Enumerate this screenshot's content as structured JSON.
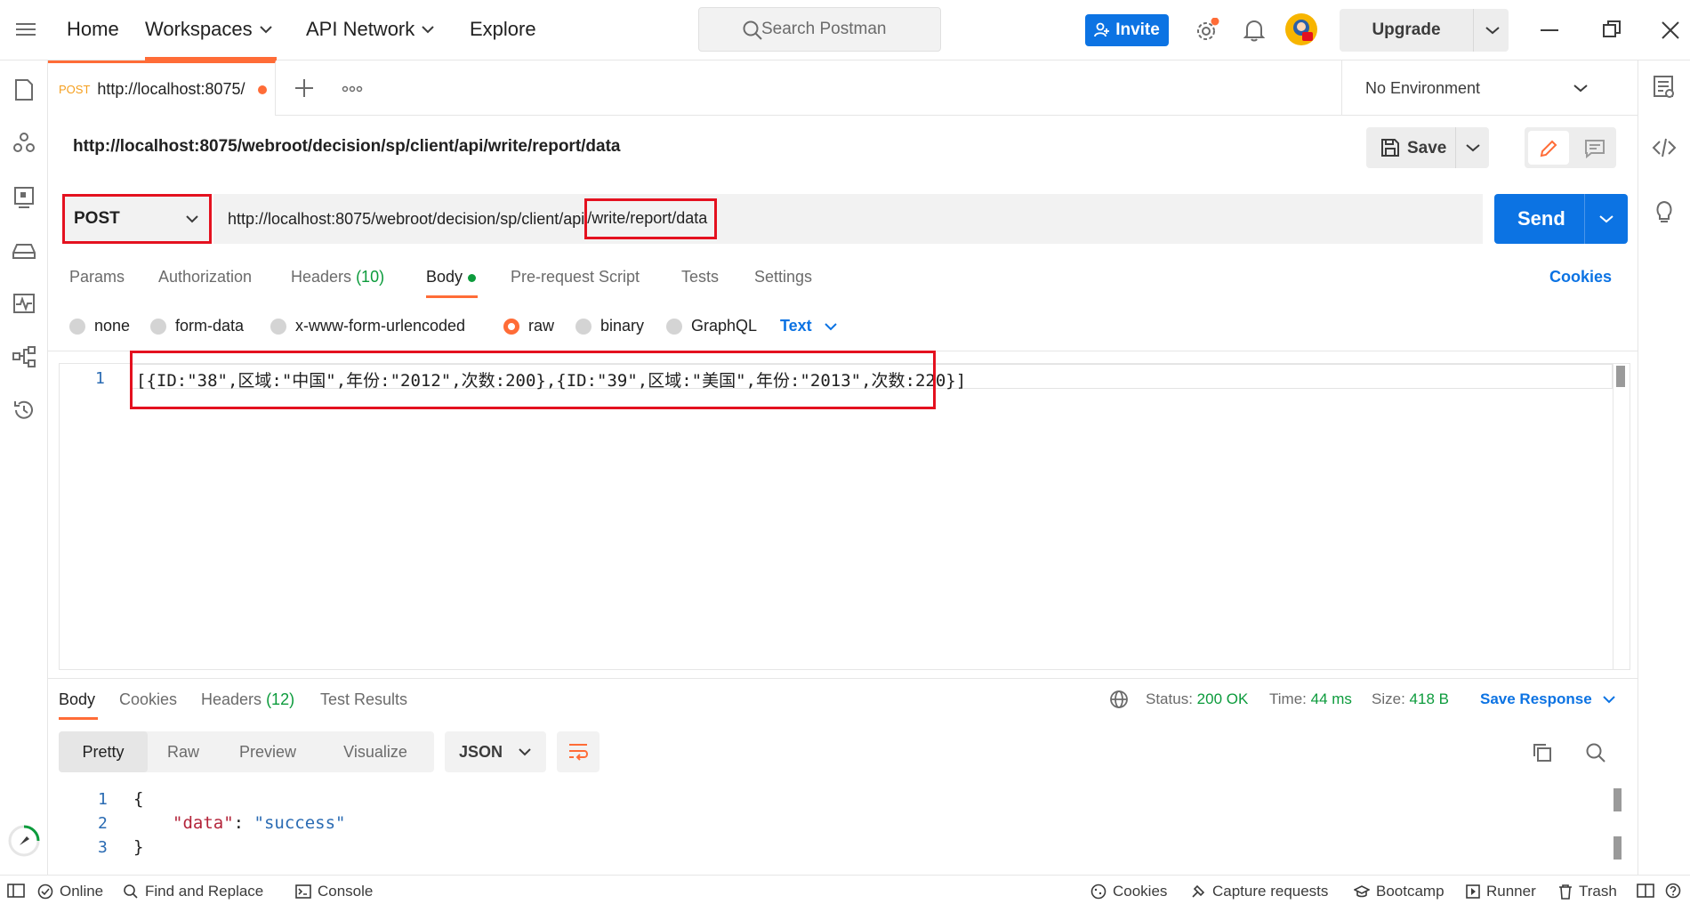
{
  "topbar": {
    "home": "Home",
    "workspaces": "Workspaces",
    "api_network": "API Network",
    "explore": "Explore",
    "search_placeholder": "Search Postman",
    "invite": "Invite",
    "upgrade": "Upgrade"
  },
  "tabs": [
    {
      "method": "POST",
      "title": "http://localhost:8075/"
    }
  ],
  "environment": "No Environment",
  "request": {
    "title": "http://localhost:8075/webroot/decision/sp/client/api/write/report/data",
    "save": "Save",
    "method": "POST",
    "url_prefix": "http://localhost:8075/webroot/decision/sp/client/api",
    "url_suffix": "/write/report/data",
    "send": "Send"
  },
  "request_tabs": {
    "params": "Params",
    "authorization": "Authorization",
    "headers": "Headers",
    "headers_count": "(10)",
    "body": "Body",
    "pre_request": "Pre-request Script",
    "tests": "Tests",
    "settings": "Settings",
    "cookies": "Cookies"
  },
  "body_types": {
    "none": "none",
    "form_data": "form-data",
    "urlencoded": "x-www-form-urlencoded",
    "raw": "raw",
    "binary": "binary",
    "graphql": "GraphQL",
    "format": "Text",
    "selected": "raw"
  },
  "editor": {
    "line_number": "1",
    "code": "[{ID:\"38\",区域:\"中国\",年份:\"2012\",次数:200},{ID:\"39\",区域:\"美国\",年份:\"2013\",次数:220}]"
  },
  "response": {
    "tabs": {
      "body": "Body",
      "cookies": "Cookies",
      "headers": "Headers",
      "headers_count": "(12)",
      "test_results": "Test Results"
    },
    "status_label": "Status:",
    "status_value": "200 OK",
    "time_label": "Time:",
    "time_value": "44 ms",
    "size_label": "Size:",
    "size_value": "418 B",
    "save_response": "Save Response",
    "views": {
      "pretty": "Pretty",
      "raw": "Raw",
      "preview": "Preview",
      "visualize": "Visualize"
    },
    "format": "JSON",
    "lines": [
      "1",
      "2",
      "3"
    ],
    "open_brace": "{",
    "key": "\"data\"",
    "colon": ": ",
    "value": "\"success\"",
    "close_brace": "}"
  },
  "statusbar": {
    "online": "Online",
    "find_replace": "Find and Replace",
    "console": "Console",
    "cookies": "Cookies",
    "capture": "Capture requests",
    "bootcamp": "Bootcamp",
    "runner": "Runner",
    "trash": "Trash"
  },
  "colors": {
    "accent_orange": "#ff6c37",
    "primary_blue": "#0c73e3",
    "highlight_red": "#e4111f",
    "success_green": "#0c9b3c"
  }
}
